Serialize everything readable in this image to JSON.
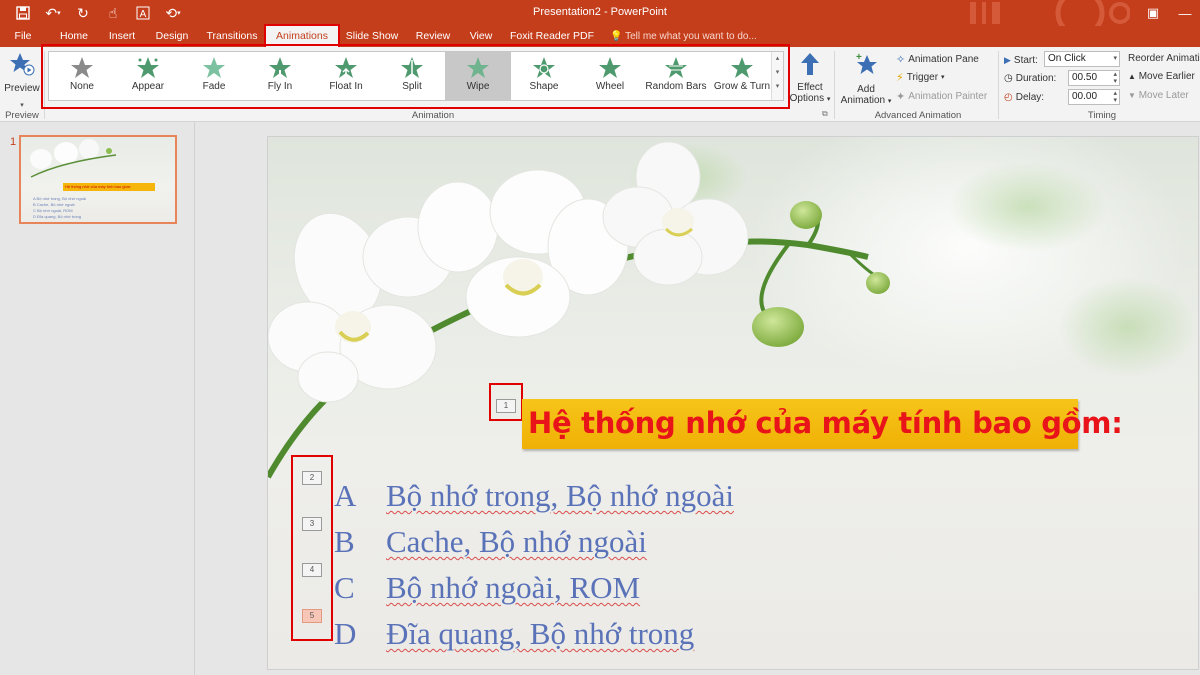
{
  "window": {
    "title": "Presentation2 - PowerPoint"
  },
  "tabs": [
    {
      "label": "File"
    },
    {
      "label": "Home"
    },
    {
      "label": "Insert"
    },
    {
      "label": "Design"
    },
    {
      "label": "Transitions"
    },
    {
      "label": "Animations"
    },
    {
      "label": "Slide Show"
    },
    {
      "label": "Review"
    },
    {
      "label": "View"
    },
    {
      "label": "Foxit Reader PDF"
    }
  ],
  "tell_me": "Tell me what you want to do...",
  "ribbon": {
    "preview": {
      "label": "Preview",
      "group": "Preview"
    },
    "animation_group": "Animation",
    "animations": [
      {
        "label": "None",
        "color": "#8a8a8a"
      },
      {
        "label": "Appear",
        "color": "#4e9a6e"
      },
      {
        "label": "Fade",
        "color": "#7cc2a0"
      },
      {
        "label": "Fly In",
        "color": "#4e9a6e"
      },
      {
        "label": "Float In",
        "color": "#4e9a6e"
      },
      {
        "label": "Split",
        "color": "#4e9a6e"
      },
      {
        "label": "Wipe",
        "color": "#6fb48e"
      },
      {
        "label": "Shape",
        "color": "#4e9a6e"
      },
      {
        "label": "Wheel",
        "color": "#4e9a6e"
      },
      {
        "label": "Random Bars",
        "color": "#4e9a6e"
      },
      {
        "label": "Grow & Turn",
        "color": "#4e9a6e"
      }
    ],
    "selected_animation": "Wipe",
    "effect_options": {
      "line1": "Effect",
      "line2": "Options"
    },
    "advanced": {
      "group": "Advanced Animation",
      "add_line1": "Add",
      "add_line2": "Animation",
      "pane": "Animation Pane",
      "trigger": "Trigger",
      "painter": "Animation Painter"
    },
    "timing": {
      "group": "Timing",
      "start_label": "Start:",
      "start_value": "On Click",
      "duration_label": "Duration:",
      "duration_value": "00.50",
      "delay_label": "Delay:",
      "delay_value": "00.00",
      "reorder": "Reorder Animation",
      "earlier": "Move Earlier",
      "later": "Move Later"
    }
  },
  "thumbnails": {
    "slide_number": "1",
    "mini_title": "Hệ thống nhớ của máy tính bao gồm:",
    "mini_lines": [
      "A   Bộ nhớ trong, Bộ nhớ ngoài",
      "B   Cache, Bộ nhớ ngoài",
      "C   Bộ nhớ ngoài, ROM",
      "D   Đĩa quang, Bộ nhớ trong"
    ]
  },
  "slide": {
    "title": "Hệ thống nhớ của máy tính bao gồm:",
    "title_tag": "1",
    "answers": [
      {
        "tag": "2",
        "letter": "A",
        "text": "Bộ nhớ trong, Bộ nhớ ngoài"
      },
      {
        "tag": "3",
        "letter": "B",
        "text": "Cache, Bộ nhớ ngoài"
      },
      {
        "tag": "4",
        "letter": "C",
        "text": "Bộ nhớ ngoài, ROM"
      },
      {
        "tag": "5",
        "letter": "D",
        "text": "Đĩa quang, Bộ nhớ trong"
      }
    ]
  },
  "colors": {
    "accent": "#c43e1c",
    "highlight": "#e00000",
    "title_bar": "#f5b50a",
    "title_text": "#e8141a",
    "answer_text": "#5a72b8"
  }
}
